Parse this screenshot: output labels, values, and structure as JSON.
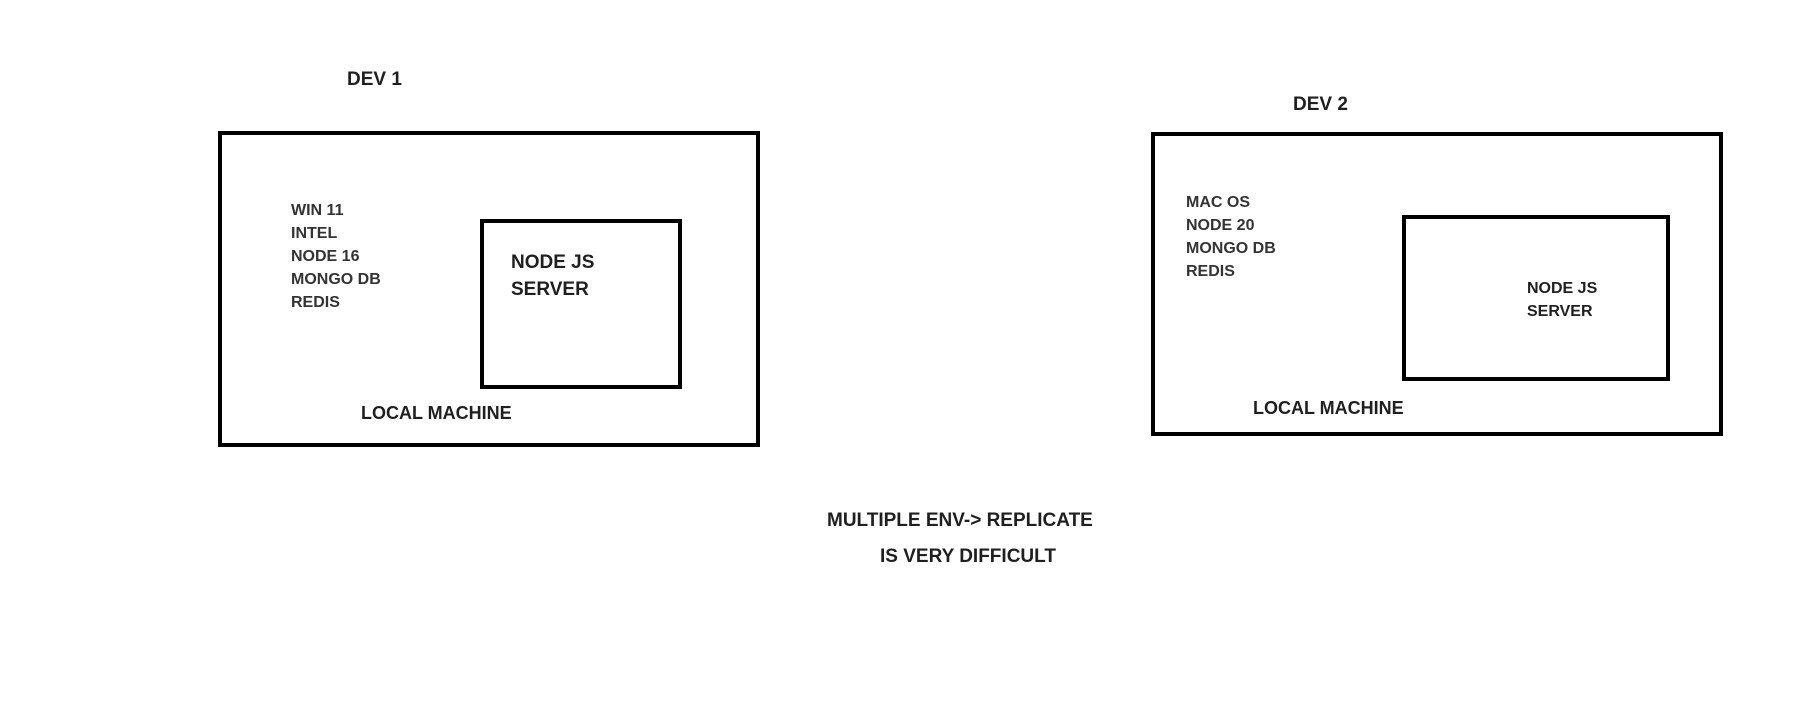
{
  "dev1": {
    "title": "DEV 1",
    "specs": [
      "WIN 11",
      "INTEL",
      "NODE 16",
      "MONGO DB",
      "REDIS"
    ],
    "server": {
      "line1": "NODE JS",
      "line2": "SERVER"
    },
    "machine_label": "LOCAL MACHINE"
  },
  "dev2": {
    "title": "DEV 2",
    "specs": [
      "MAC OS",
      "NODE 20",
      "MONGO DB",
      "REDIS"
    ],
    "server": {
      "line1": "NODE JS",
      "line2": "SERVER"
    },
    "machine_label": "LOCAL MACHINE"
  },
  "note": {
    "line1": "MULTIPLE ENV-> REPLICATE",
    "line2": "IS VERY DIFFICULT"
  },
  "colors": {
    "stroke": "#000000",
    "text": "#1f1f1f",
    "background": "#ffffff"
  }
}
